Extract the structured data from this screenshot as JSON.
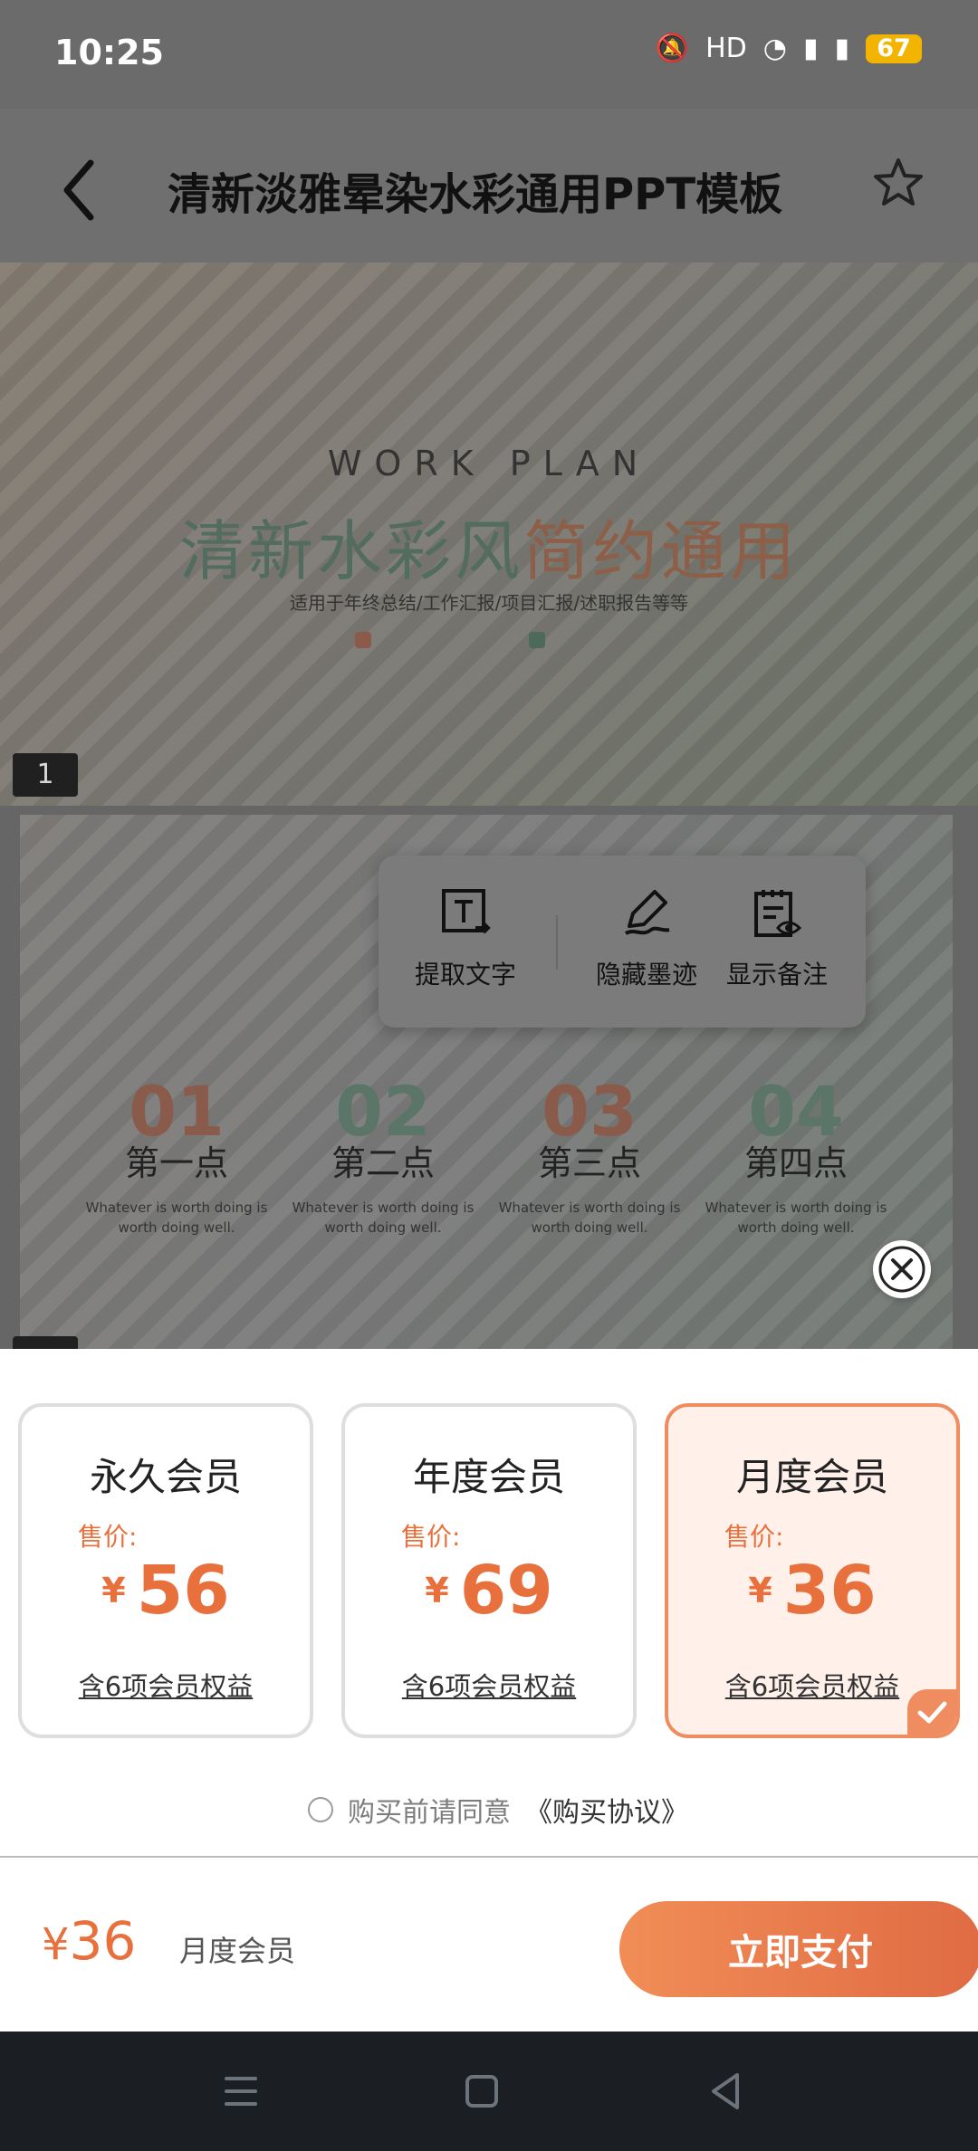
{
  "status_bar": {
    "time": "10:25",
    "icons": [
      "bell-off-icon",
      "hd-icon",
      "wifi-icon",
      "signal-5g-icon",
      "signal-5g-icon"
    ],
    "battery": "67"
  },
  "header": {
    "title": "清新淡雅晕染水彩通用PPT模板"
  },
  "slide1": {
    "kicker": "WORK PLAN",
    "heading_main": "清新水彩风",
    "heading_accent": "简约通用",
    "subtitle": "适用于年终总结/工作汇报/项目汇报/述职报告等等",
    "number": "1"
  },
  "tool_panel": {
    "extract_text": "提取文字",
    "hide_ink": "隐藏墨迹",
    "show_notes": "显示备注"
  },
  "slide2_points": [
    {
      "num": "01",
      "title": "第一点",
      "desc": "Whatever is worth doing is worth doing well.",
      "color": "#8a5a4b"
    },
    {
      "num": "02",
      "title": "第二点",
      "desc": "Whatever is worth doing is worth doing well.",
      "color": "#5b7668"
    },
    {
      "num": "03",
      "title": "第三点",
      "desc": "Whatever is worth doing is worth doing well.",
      "color": "#8a5a4b"
    },
    {
      "num": "04",
      "title": "第四点",
      "desc": "Whatever is worth doing is worth doing well.",
      "color": "#5b7668"
    }
  ],
  "plans": [
    {
      "title": "永久会员",
      "price_label": "售价:",
      "currency": "¥",
      "price": "56",
      "benefit": "含6项会员权益",
      "selected": false
    },
    {
      "title": "年度会员",
      "price_label": "售价:",
      "currency": "¥",
      "price": "69",
      "benefit": "含6项会员权益",
      "selected": false
    },
    {
      "title": "月度会员",
      "price_label": "售价:",
      "currency": "¥",
      "price": "36",
      "benefit": "含6项会员权益",
      "selected": true
    }
  ],
  "agreement": {
    "prefix": "购买前请同意",
    "link": "《购买协议》"
  },
  "pay_bar": {
    "currency": "¥",
    "amount": "36",
    "plan_name": "月度会员",
    "pay_button": "立即支付"
  },
  "colors": {
    "accent": "#e8703d",
    "selected_bg": "#fff1ea",
    "nav_bg": "#1b1f24"
  }
}
